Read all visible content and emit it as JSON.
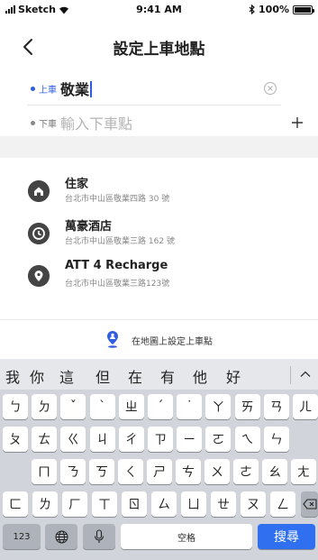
{
  "status_bar": {
    "carrier": "Sketch",
    "time": "9:41 AM",
    "battery": "100%",
    "battery_level": 1.0,
    "icons": [
      "signal-icon",
      "wifi-icon",
      "bluetooth-icon",
      "battery-icon"
    ]
  },
  "header": {
    "title": "設定上車地點",
    "back_icon": "chevron-left-icon"
  },
  "route": {
    "pickup": {
      "label": "上車",
      "value": "敬業",
      "dot_color": "#2f5fe0"
    },
    "dropoff": {
      "label": "下車",
      "placeholder": "輸入下車點",
      "dot_color": "#888888"
    },
    "clear_icon": "clear-circle-icon",
    "add_icon": "plus-icon"
  },
  "places": [
    {
      "name": "住家",
      "address": "台北市中山區敬業四路 30 號",
      "icon": "home-icon"
    },
    {
      "name": "萬豪酒店",
      "address": "台北市中山區敬業三路 162 號",
      "icon": "clock-icon"
    },
    {
      "name": "ATT 4 Recharge",
      "address": "台北市中山區敬業三路123號",
      "icon": "location-pin-icon"
    }
  ],
  "map_link": {
    "label": "在地圖上設定上車點",
    "icon": "person-pin-icon",
    "icon_color": "#2f5fe0"
  },
  "keyboard": {
    "candidates": [
      "我",
      "你",
      "這",
      "但",
      "在",
      "有",
      "他",
      "好"
    ],
    "expand_icon": "chevron-up-icon",
    "row1": [
      "ㄅ",
      "ㄉ",
      "ˇ",
      "ˋ",
      "ㄓ",
      "ˊ",
      "˙",
      "ㄚ",
      "ㄞ",
      "ㄢ",
      "ㄦ"
    ],
    "row2": [
      "ㄆ",
      "ㄊ",
      "ㄍ",
      "ㄐ",
      "ㄔ",
      "ㄗ",
      "ㄧ",
      "ㄛ",
      "ㄟ",
      "ㄣ"
    ],
    "row3": [
      "ㄇ",
      "ㄋ",
      "ㄎ",
      "ㄑ",
      "ㄕ",
      "ㄘ",
      "ㄨ",
      "ㄜ",
      "ㄠ",
      "ㄤ"
    ],
    "row4": [
      "ㄈ",
      "ㄌ",
      "ㄏ",
      "ㄒ",
      "ㄖ",
      "ㄙ",
      "ㄩ",
      "ㄝ",
      "ㄡ",
      "ㄥ"
    ],
    "delete_icon": "delete-backspace-icon",
    "numbers_label": "123",
    "globe_icon": "globe-icon",
    "mic_icon": "microphone-icon",
    "space_label": "空格",
    "search_label": "搜尋",
    "accent_color": "#2f6ff0"
  }
}
